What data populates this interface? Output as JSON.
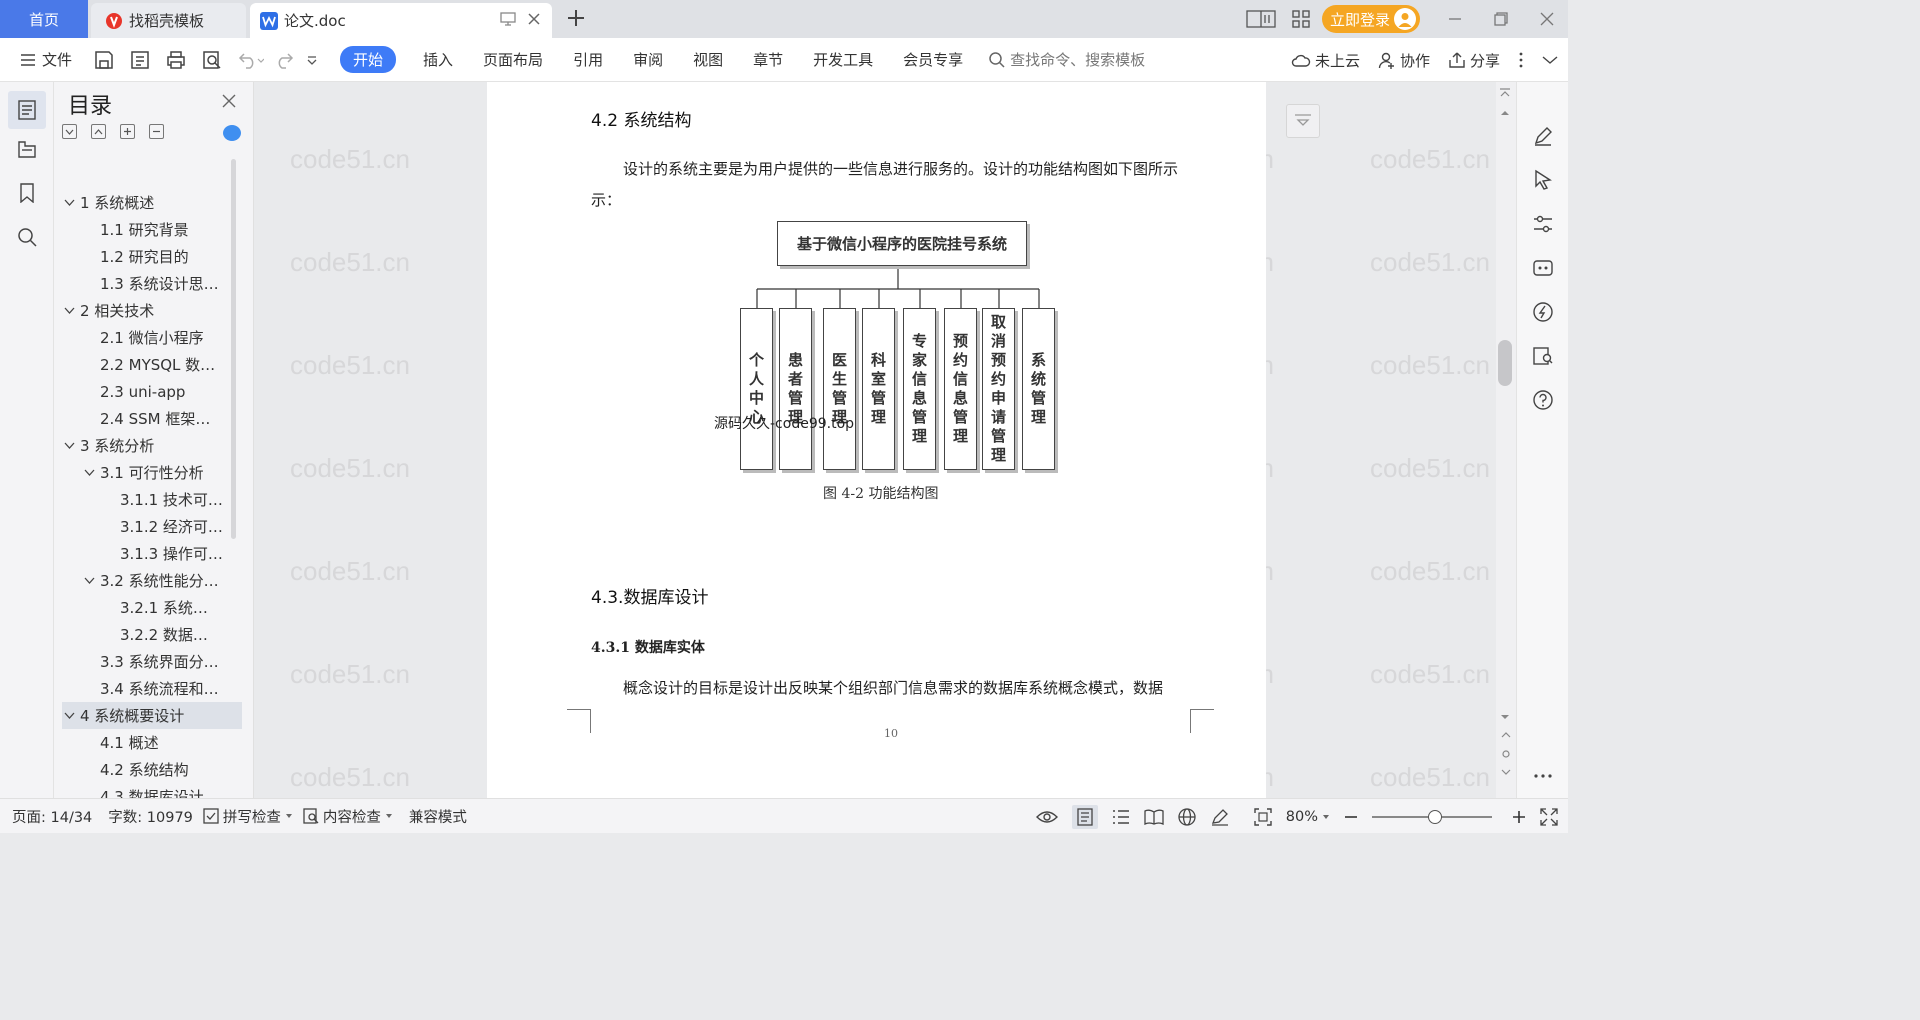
{
  "tabs": {
    "home": "首页",
    "templates": "找稻壳模板",
    "document": "论文.doc",
    "login": "立即登录"
  },
  "ribbon": {
    "file": "文件",
    "menus": [
      "开始",
      "插入",
      "页面布局",
      "引用",
      "审阅",
      "视图",
      "章节",
      "开发工具",
      "会员专享"
    ],
    "search_placeholder": "查找命令、搜索模板",
    "cloud": "未上云",
    "collab": "协作",
    "share": "分享"
  },
  "toc": {
    "title": "目录",
    "items": [
      {
        "label": "1 系统概述",
        "level": 1,
        "expand": "down"
      },
      {
        "label": "1.1  研究背景",
        "level": 2
      },
      {
        "label": "1.2 研究目的",
        "level": 2
      },
      {
        "label": "1.3 系统设计思…",
        "level": 2
      },
      {
        "label": "2 相关技术",
        "level": 1,
        "expand": "down"
      },
      {
        "label": "2.1 微信小程序",
        "level": 2
      },
      {
        "label": "2.2 MYSQL 数…",
        "level": 2
      },
      {
        "label": "2.3 uni-app",
        "level": 2
      },
      {
        "label": "2.4 SSM 框架…",
        "level": 2
      },
      {
        "label": "3 系统分析",
        "level": 1,
        "expand": "down"
      },
      {
        "label": "3.1 可行性分析",
        "level": 2,
        "expand": "down"
      },
      {
        "label": "3.1.1 技术可…",
        "level": 3
      },
      {
        "label": "3.1.2 经济可…",
        "level": 3
      },
      {
        "label": "3.1.3 操作可…",
        "level": 3
      },
      {
        "label": "3.2 系统性能分…",
        "level": 2,
        "expand": "down"
      },
      {
        "label": "3.2.1  系统…",
        "level": 3
      },
      {
        "label": "3.2.2  数据…",
        "level": 3
      },
      {
        "label": "3.3 系统界面分…",
        "level": 2
      },
      {
        "label": "3.4 系统流程和…",
        "level": 2
      },
      {
        "label": "4 系统概要设计",
        "level": 1,
        "expand": "down",
        "selected": true
      },
      {
        "label": "4.1 概述",
        "level": 2
      },
      {
        "label": "4.2 系统结构",
        "level": 2
      },
      {
        "label": "4.3 数据库设计",
        "level": 2
      }
    ]
  },
  "document": {
    "heading_42": "4.2 系统结构",
    "para1_line1": "设计的系统主要是为用户提供的一些信息进行服务的。设计的功能结构图如下图所示",
    "para1_line2": "示：",
    "figure": {
      "root": "基于微信小程序的医院挂号系统",
      "modules": [
        "个人中心",
        "患者管理",
        "医生管理",
        "科室管理",
        "专家信息管理",
        "预约信息管理",
        "取消预约申请管理",
        "系统管理"
      ],
      "caption": "图 4-2 功能结构图"
    },
    "overlay_text": "源码久久-code99.top",
    "heading_43": "4.3.数据库设计",
    "heading_431": "4.3.1 数据库实体",
    "para2": "概念设计的目标是设计出反映某个组织部门信息需求的数据库系统概念模式，数据",
    "page_number": "10",
    "watermark": "code51.cn"
  },
  "status": {
    "page": "页面: 14/34",
    "words": "字数: 10979",
    "spell": "拼写检查",
    "content_check": "内容检查",
    "compat": "兼容模式",
    "zoom": "80%"
  },
  "colors": {
    "accent": "#3e7bf7",
    "home_tab": "#4a79e8",
    "login": "#f5a623"
  }
}
